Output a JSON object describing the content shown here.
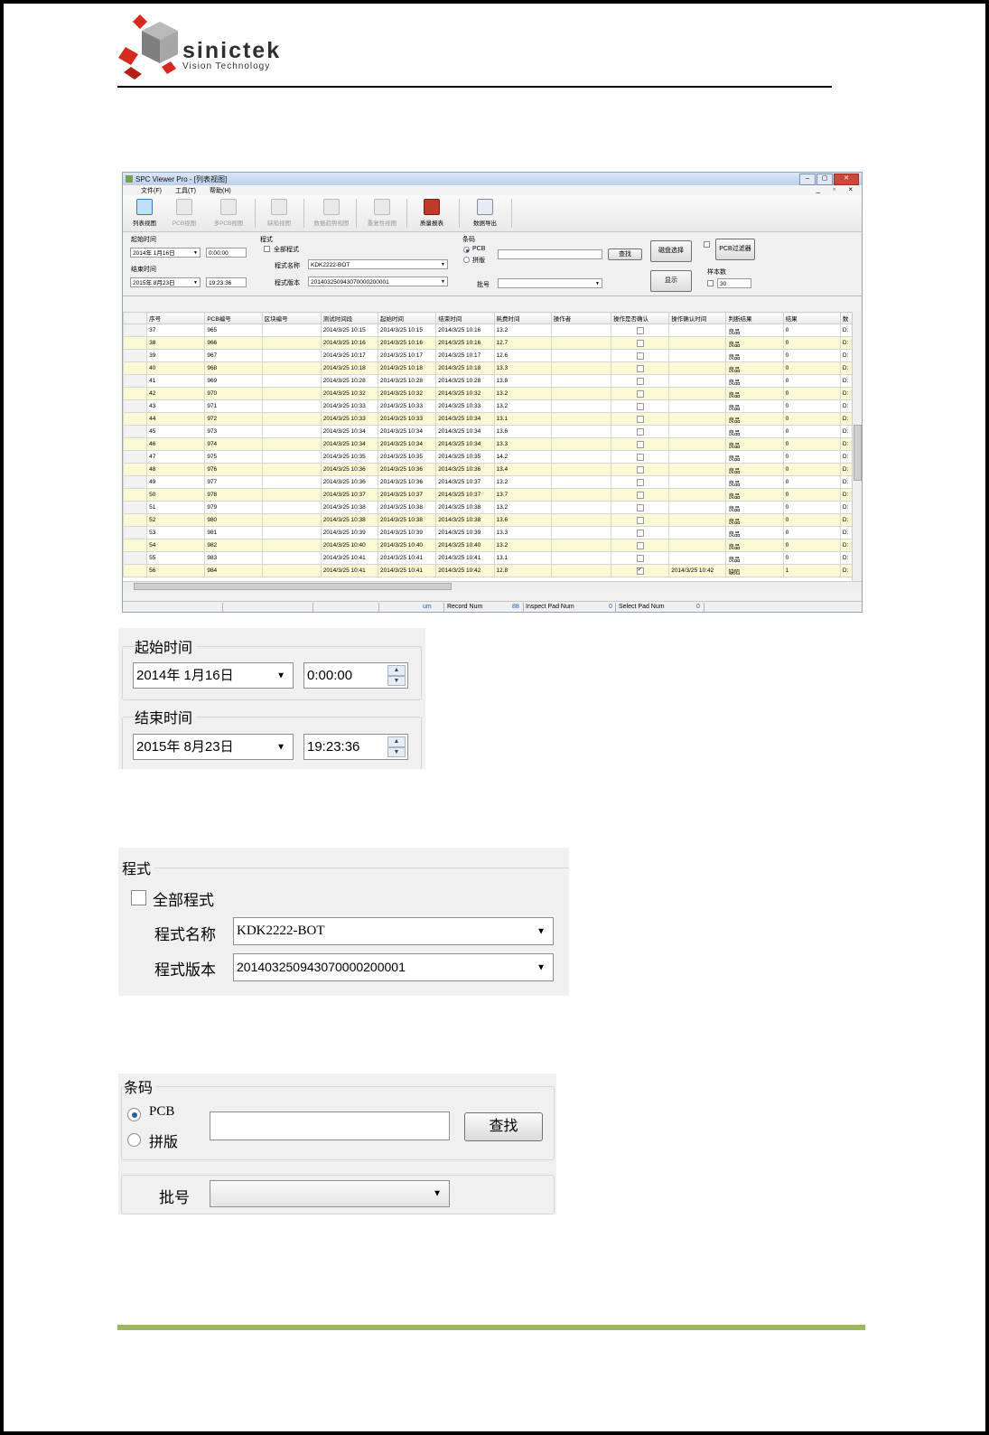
{
  "logo": {
    "brand": "sinictek",
    "tagline": "Vision Technology"
  },
  "app": {
    "title": "SPC Viewer Pro - [列表视图]",
    "window_buttons": [
      "–",
      "▢",
      "✕"
    ],
    "menu": [
      "文件(F)",
      "工具(T)",
      "帮助(H)"
    ],
    "mdi_controls": "_ ▫ ×",
    "toolbar": [
      {
        "label": "列表视图",
        "icon": "list-view-icon",
        "state": "active"
      },
      {
        "label": "PCB视图",
        "icon": "pcb-view-icon",
        "state": "disabled"
      },
      {
        "label": "多PCB视图",
        "icon": "multi-pcb-view-icon",
        "state": "disabled"
      },
      {
        "label": "缺陷视图",
        "icon": "defect-view-icon",
        "state": "disabled"
      },
      {
        "label": "数据趋势视图",
        "icon": "trend-view-icon",
        "state": "disabled"
      },
      {
        "label": "重复性视图",
        "icon": "repeatability-view-icon",
        "state": "disabled"
      },
      {
        "label": "质量报表",
        "icon": "quality-report-icon",
        "state": "normal"
      },
      {
        "label": "数据导出",
        "icon": "data-export-icon",
        "state": "normal"
      }
    ],
    "filters": {
      "start_label": "起始时间",
      "start_date": "2014年 1月16日",
      "start_time": "0:00:00",
      "end_label": "结束时间",
      "end_date": "2015年 8月23日",
      "end_time": "19:23:36",
      "program_label": "程式",
      "all_programs": "全部程式",
      "program_name_label": "程式名称",
      "program_name": "KDK2222-BOT",
      "program_version_label": "程式版本",
      "program_version": "20140325094307000020000​1",
      "barcode_label": "条码",
      "radio_pcb": "PCB",
      "radio_panel": "拼版",
      "find_button": "查找",
      "batch_label": "批号",
      "disk_select": "磁盘选择",
      "pcb_filter": "PCB过滤器",
      "show_button": "显示",
      "sample_label": "样本数",
      "sample_value": "30"
    },
    "grid": {
      "columns": [
        "序号",
        "PCB编号",
        "区块编号",
        "测试时间段",
        "起始时间",
        "结束时间",
        "耗费时间",
        "操作者",
        "操作是否确认",
        "操作确认时间",
        "判断结果",
        "结果",
        "数"
      ],
      "rows": [
        [
          "37",
          "965",
          "",
          "2014/3/25 10:15",
          "2014/3/25 10:15",
          "2014/3/25 10:16",
          "13.2",
          "",
          false,
          "",
          "良品",
          "0",
          "D:"
        ],
        [
          "38",
          "966",
          "",
          "2014/3/25 10:16",
          "2014/3/25 10:16",
          "2014/3/25 10:16",
          "12.7",
          "",
          false,
          "",
          "良品",
          "0",
          "D:"
        ],
        [
          "39",
          "967",
          "",
          "2014/3/25 10:17",
          "2014/3/25 10:17",
          "2014/3/25 10:17",
          "12.6",
          "",
          false,
          "",
          "良品",
          "0",
          "D:"
        ],
        [
          "40",
          "968",
          "",
          "2014/3/25 10:18",
          "2014/3/25 10:18",
          "2014/3/25 10:18",
          "13.3",
          "",
          false,
          "",
          "良品",
          "0",
          "D:"
        ],
        [
          "41",
          "969",
          "",
          "2014/3/25 10:28",
          "2014/3/25 10:28",
          "2014/3/25 10:28",
          "13.8",
          "",
          false,
          "",
          "良品",
          "0",
          "D:"
        ],
        [
          "42",
          "970",
          "",
          "2014/3/25 10:32",
          "2014/3/25 10:32",
          "2014/3/25 10:32",
          "13.2",
          "",
          false,
          "",
          "良品",
          "0",
          "D:"
        ],
        [
          "43",
          "971",
          "",
          "2014/3/25 10:33",
          "2014/3/25 10:33",
          "2014/3/25 10:33",
          "13.2",
          "",
          false,
          "",
          "良品",
          "0",
          "D:"
        ],
        [
          "44",
          "972",
          "",
          "2014/3/25 10:33",
          "2014/3/25 10:33",
          "2014/3/25 10:34",
          "13.1",
          "",
          false,
          "",
          "良品",
          "0",
          "D:"
        ],
        [
          "45",
          "973",
          "",
          "2014/3/25 10:34",
          "2014/3/25 10:34",
          "2014/3/25 10:34",
          "13.6",
          "",
          false,
          "",
          "良品",
          "0",
          "D:"
        ],
        [
          "46",
          "974",
          "",
          "2014/3/25 10:34",
          "2014/3/25 10:34",
          "2014/3/25 10:34",
          "13.3",
          "",
          false,
          "",
          "良品",
          "0",
          "D:"
        ],
        [
          "47",
          "975",
          "",
          "2014/3/25 10:35",
          "2014/3/25 10:35",
          "2014/3/25 10:35",
          "14.2",
          "",
          false,
          "",
          "良品",
          "0",
          "D:"
        ],
        [
          "48",
          "976",
          "",
          "2014/3/25 10:36",
          "2014/3/25 10:36",
          "2014/3/25 10:36",
          "13.4",
          "",
          false,
          "",
          "良品",
          "0",
          "D:"
        ],
        [
          "49",
          "977",
          "",
          "2014/3/25 10:36",
          "2014/3/25 10:36",
          "2014/3/25 10:37",
          "13.2",
          "",
          false,
          "",
          "良品",
          "0",
          "D:"
        ],
        [
          "50",
          "978",
          "",
          "2014/3/25 10:37",
          "2014/3/25 10:37",
          "2014/3/25 10:37",
          "13.7",
          "",
          false,
          "",
          "良品",
          "0",
          "D:"
        ],
        [
          "51",
          "979",
          "",
          "2014/3/25 10:38",
          "2014/3/25 10:38",
          "2014/3/25 10:38",
          "13.2",
          "",
          false,
          "",
          "良品",
          "0",
          "D:"
        ],
        [
          "52",
          "980",
          "",
          "2014/3/25 10:38",
          "2014/3/25 10:38",
          "2014/3/25 10:38",
          "13.6",
          "",
          false,
          "",
          "良品",
          "0",
          "D:"
        ],
        [
          "53",
          "981",
          "",
          "2014/3/25 10:39",
          "2014/3/25 10:39",
          "2014/3/25 10:39",
          "13.3",
          "",
          false,
          "",
          "良品",
          "0",
          "D:"
        ],
        [
          "54",
          "982",
          "",
          "2014/3/25 10:40",
          "2014/3/25 10:40",
          "2014/3/25 10:40",
          "13.2",
          "",
          false,
          "",
          "良品",
          "0",
          "D:"
        ],
        [
          "55",
          "983",
          "",
          "2014/3/25 10:41",
          "2014/3/25 10:41",
          "2014/3/25 10:41",
          "13.1",
          "",
          false,
          "",
          "良品",
          "0",
          "D:"
        ],
        [
          "56",
          "984",
          "",
          "2014/3/25 10:41",
          "2014/3/25 10:41",
          "2014/3/25 10:42",
          "12.8",
          "",
          true,
          "2014/3/25 10:42",
          "缺陷",
          "1",
          "D:"
        ]
      ]
    },
    "status": {
      "um": "um",
      "record_label": "Record Num",
      "record_value": "88",
      "inspect_label": "Inspect Pad Num",
      "inspect_value": "0",
      "select_label": "Select Pad Num",
      "select_value": "0"
    }
  },
  "zoom_time": {
    "start_label": "起始时间",
    "start_date": "2014年  1月16日",
    "start_time": "0:00:00",
    "end_label": "结束时间",
    "end_date": "2015年  8月23日",
    "end_time": "19:23:36"
  },
  "zoom_program": {
    "group_label": "程式",
    "all_programs": "全部程式",
    "name_label": "程式名称",
    "name_value": "KDK2222-BOT",
    "version_label": "程式版本",
    "version_value": "201403250943070000200001"
  },
  "zoom_barcode": {
    "group_label": "条码",
    "radio_pcb": "PCB",
    "radio_panel": "拼版",
    "find_button": "查找",
    "batch_label": "批号"
  }
}
